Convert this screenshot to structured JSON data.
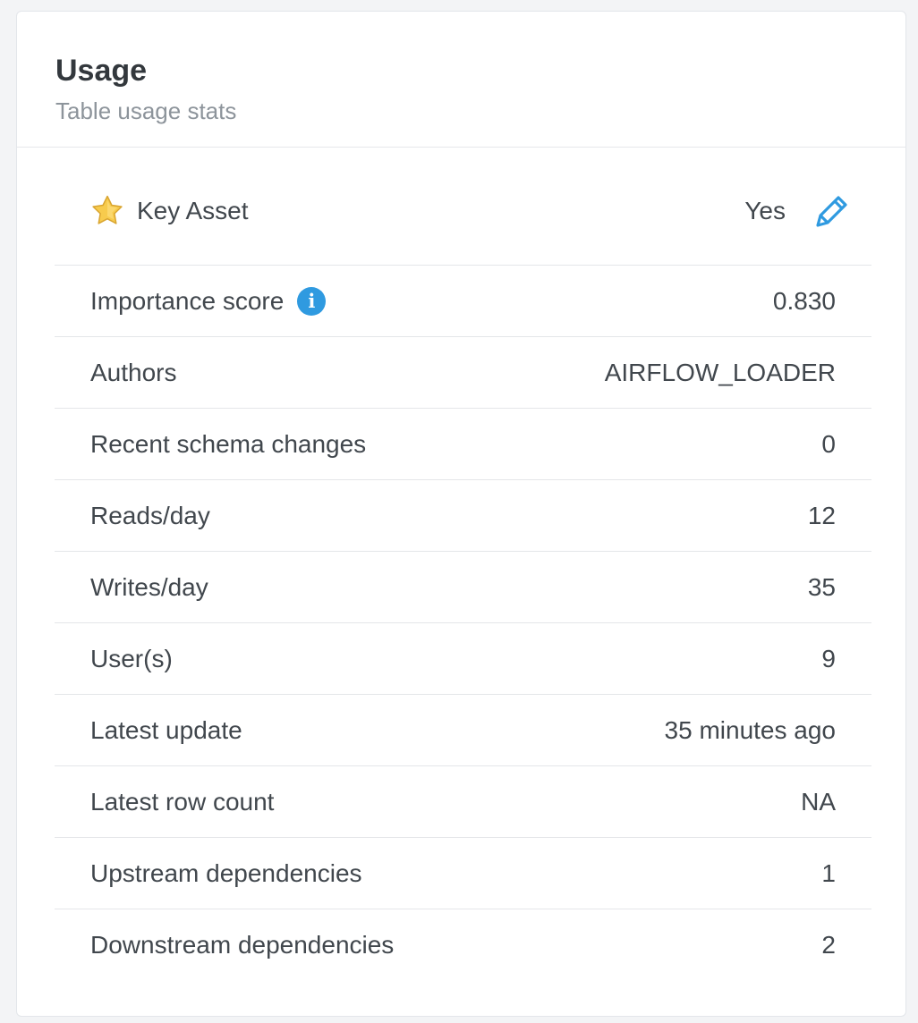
{
  "panel": {
    "title": "Usage",
    "subtitle": "Table usage stats"
  },
  "key_asset": {
    "label": "Key Asset",
    "value": "Yes",
    "icon": "star-icon",
    "edit_icon": "pencil-icon"
  },
  "stats": [
    {
      "label": "Importance score",
      "value": "0.830",
      "info_icon": "info-icon"
    },
    {
      "label": "Authors",
      "value": "AIRFLOW_LOADER"
    },
    {
      "label": "Recent schema changes",
      "value": "0"
    },
    {
      "label": "Reads/day",
      "value": "12"
    },
    {
      "label": "Writes/day",
      "value": "35"
    },
    {
      "label": "User(s)",
      "value": "9"
    },
    {
      "label": "Latest update",
      "value": "35 minutes ago"
    },
    {
      "label": "Latest row count",
      "value": "NA"
    },
    {
      "label": "Upstream dependencies",
      "value": "1"
    },
    {
      "label": "Downstream dependencies",
      "value": "2"
    }
  ],
  "colors": {
    "accent": "#2f9ae0",
    "star": "#f6c343",
    "text": "#41474d",
    "muted": "#8d949b"
  }
}
